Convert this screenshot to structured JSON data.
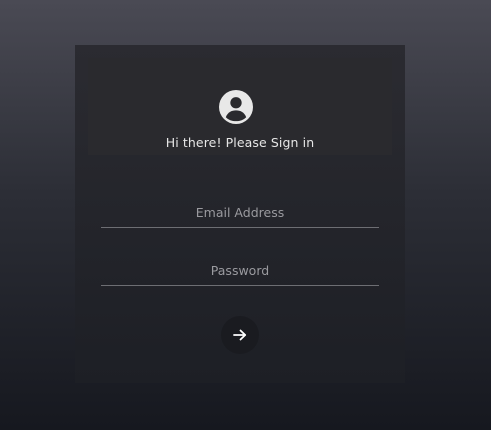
{
  "header": {
    "avatar_icon": "account-circle-icon",
    "greeting": "Hi there! Please Sign in"
  },
  "form": {
    "email_placeholder": "Email Address",
    "password_placeholder": "Password",
    "submit_icon": "arrow-right-icon"
  },
  "colors": {
    "card_background": "#25262c",
    "header_background": "#2a2a2e",
    "text": "#e6e6e6",
    "placeholder": "#9a9a9f",
    "underline": "#6d6e73",
    "submit_button": "#1a1b20"
  }
}
